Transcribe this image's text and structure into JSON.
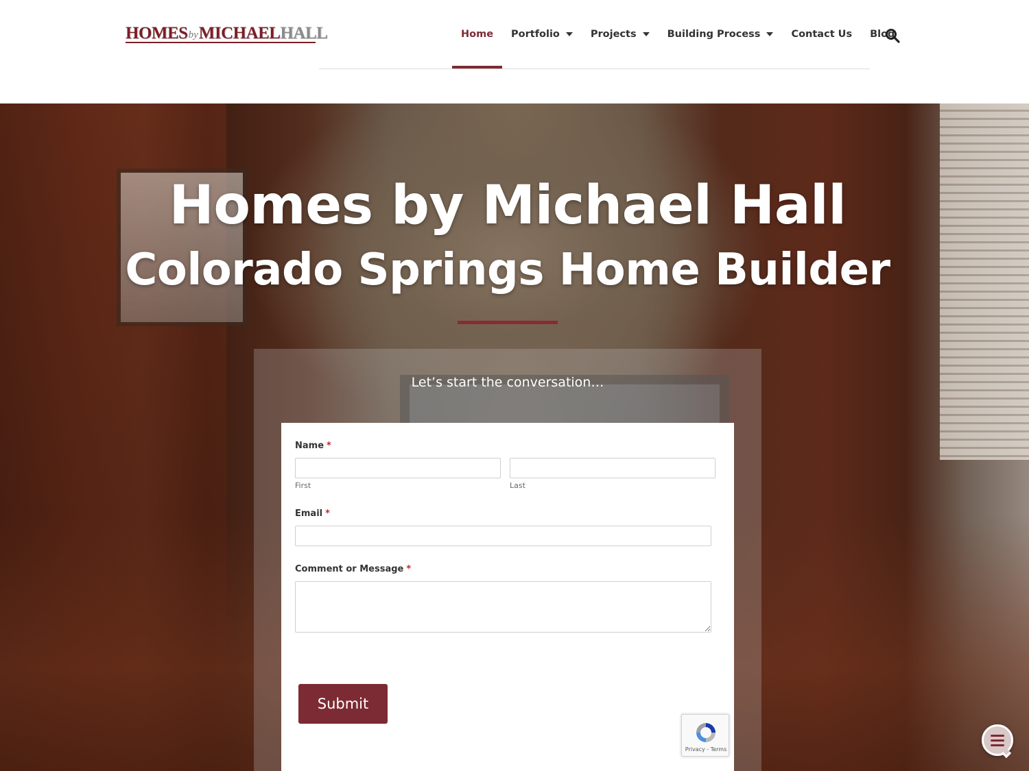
{
  "header": {
    "logo": {
      "part1": "HOMES",
      "by": "by",
      "part2": "MICHAEL",
      "part3": "HALL"
    },
    "nav": [
      {
        "label": "Home",
        "active": true,
        "has_dropdown": false
      },
      {
        "label": "Portfolio",
        "active": false,
        "has_dropdown": true
      },
      {
        "label": "Projects",
        "active": false,
        "has_dropdown": true
      },
      {
        "label": "Building Process",
        "active": false,
        "has_dropdown": true
      },
      {
        "label": "Contact Us",
        "active": false,
        "has_dropdown": false
      },
      {
        "label": "Blog",
        "active": false,
        "has_dropdown": false
      }
    ],
    "search_icon": "search-icon"
  },
  "hero": {
    "title": "Homes by Michael Hall",
    "subtitle": "Colorado Springs Home Builder"
  },
  "form": {
    "intro": "Let’s start the conversation…",
    "name_label": "Name",
    "required_mark": "*",
    "first_sublabel": "First",
    "last_sublabel": "Last",
    "first_value": "",
    "last_value": "",
    "email_label": "Email",
    "email_value": "",
    "message_label": "Comment or Message",
    "message_value": "",
    "submit_label": "Submit"
  },
  "recaptcha": {
    "links": "Privacy - Terms"
  },
  "chat": {
    "icon": "chat-menu-icon"
  },
  "colors": {
    "brand": "#7c2b34",
    "required": "#c0282d",
    "text": "#333333"
  }
}
